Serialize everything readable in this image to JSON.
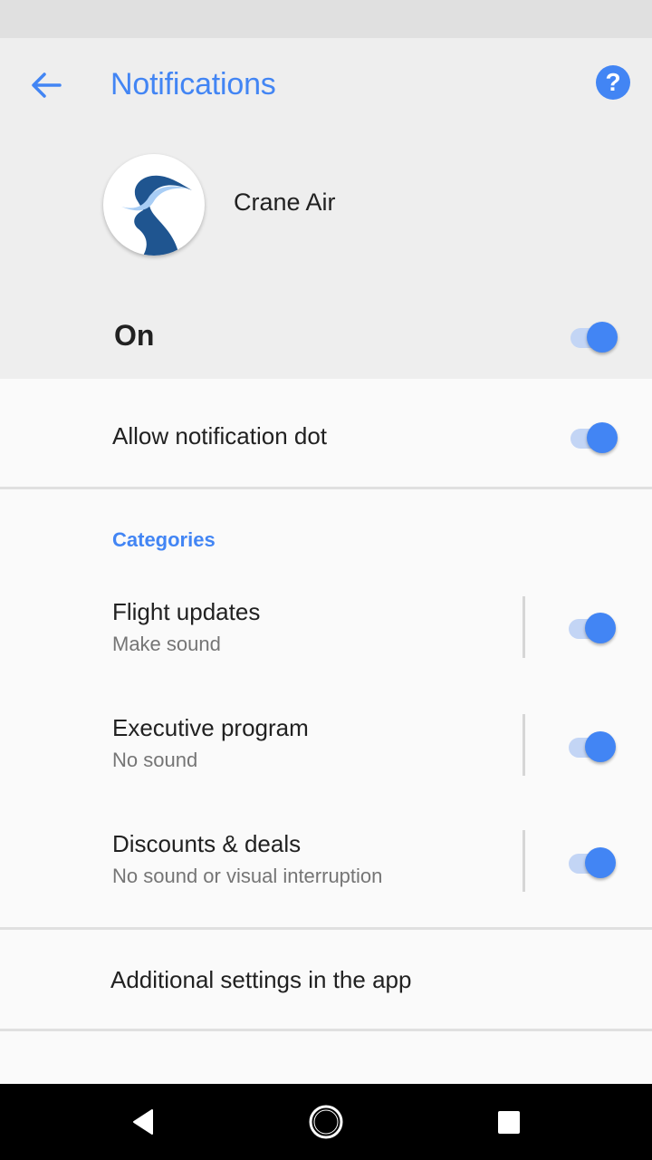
{
  "header": {
    "title": "Notifications",
    "back_icon": "arrow-left-icon",
    "help_icon": "help-circle-icon"
  },
  "app": {
    "name": "Crane Air",
    "icon": "crane-logo-icon"
  },
  "master_toggle": {
    "label": "On",
    "checked": true
  },
  "notification_dot": {
    "label": "Allow notification dot",
    "checked": true
  },
  "categories": {
    "title": "Categories",
    "items": [
      {
        "title": "Flight updates",
        "subtitle": "Make sound",
        "checked": true
      },
      {
        "title": "Executive program",
        "subtitle": "No sound",
        "checked": true
      },
      {
        "title": "Discounts & deals",
        "subtitle": "No sound or visual interruption",
        "checked": true
      }
    ]
  },
  "additional": {
    "label": "Additional settings in the app"
  },
  "navbar": {
    "back": "nav-back-icon",
    "home": "nav-home-icon",
    "recents": "nav-recents-icon"
  },
  "colors": {
    "accent": "#4285f4",
    "switch_track": "#c3d5f5"
  }
}
